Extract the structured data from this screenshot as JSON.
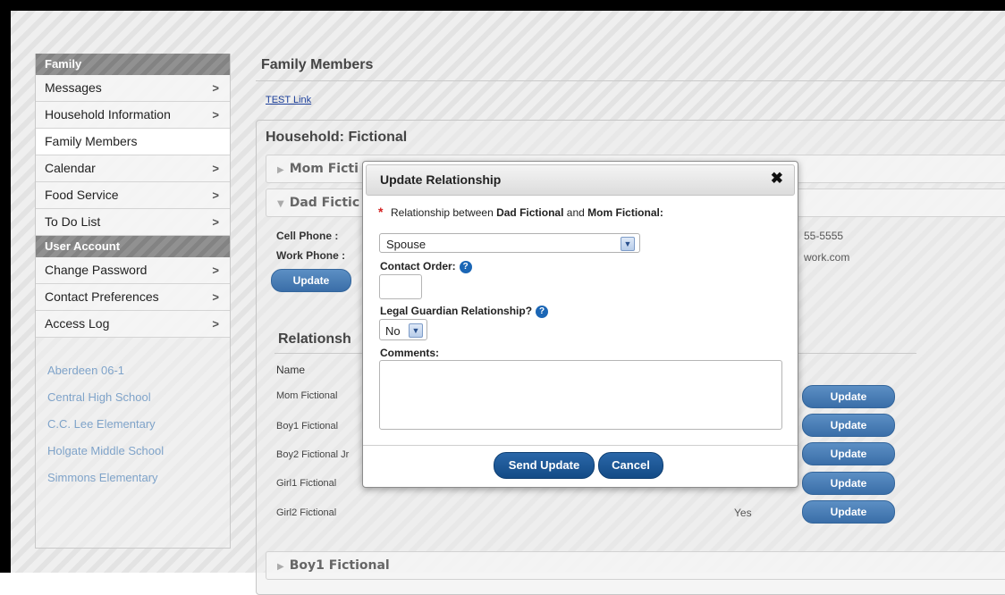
{
  "sidebar": {
    "family_header": "Family",
    "family_items": [
      {
        "label": "Messages",
        "chevron": ">"
      },
      {
        "label": "Household Information",
        "chevron": ">"
      },
      {
        "label": "Family Members",
        "chevron": ""
      },
      {
        "label": "Calendar",
        "chevron": ">"
      },
      {
        "label": "Food Service",
        "chevron": ">"
      },
      {
        "label": "To Do List",
        "chevron": ">"
      }
    ],
    "account_header": "User Account",
    "account_items": [
      {
        "label": "Change Password",
        "chevron": ">"
      },
      {
        "label": "Contact Preferences",
        "chevron": ">"
      },
      {
        "label": "Access Log",
        "chevron": ">"
      }
    ],
    "schools": [
      "Aberdeen 06-1",
      "Central High School",
      "C.C. Lee Elementary",
      "Holgate Middle School",
      "Simmons Elementary"
    ]
  },
  "main": {
    "title": "Family Members",
    "test_link": "TEST Link",
    "household_title": "Household: Fictional",
    "mom_bar": "Mom Ficti",
    "dad_bar": "Dad Fictic",
    "boy1_bar": "Boy1 Fictional",
    "cell_phone_label": "Cell Phone :",
    "work_phone_label": "Work Phone :",
    "phone_tail": "55-5555",
    "email_tail": "work.com",
    "update_label": "Update",
    "relationships_title": "Relationsh",
    "name_header": "Name",
    "relationships": [
      {
        "name": "Mom Fictional",
        "yes": "",
        "button": "Update"
      },
      {
        "name": "Boy1 Fictional",
        "yes": "",
        "button": "Update"
      },
      {
        "name": "Boy2 Fictional Jr",
        "yes": "",
        "button": "Update"
      },
      {
        "name": "Girl1 Fictional",
        "yes": "",
        "button": "Update"
      },
      {
        "name": "Girl2 Fictional",
        "yes": "Yes",
        "button": "Update"
      }
    ]
  },
  "modal": {
    "title": "Update Relationship",
    "close": "✖",
    "required_star": "*",
    "relationship_prefix": "Relationship between",
    "person_a": "Dad Fictional",
    "and_text": "and",
    "person_b": "Mom Fictional:",
    "relationship_value": "Spouse",
    "contact_order_label": "Contact Order:",
    "contact_order_value": "",
    "legal_guardian_label": "Legal Guardian Relationship?",
    "legal_guardian_value": "No",
    "comments_label": "Comments:",
    "comments_value": "",
    "help_glyph": "?",
    "send_button": "Send Update",
    "cancel_button": "Cancel"
  },
  "colors": {
    "accent_blue": "#134b86",
    "pill_blue": "#4a7fb8",
    "school_link": "#7fa3c9",
    "required_red": "#d31f1f"
  }
}
